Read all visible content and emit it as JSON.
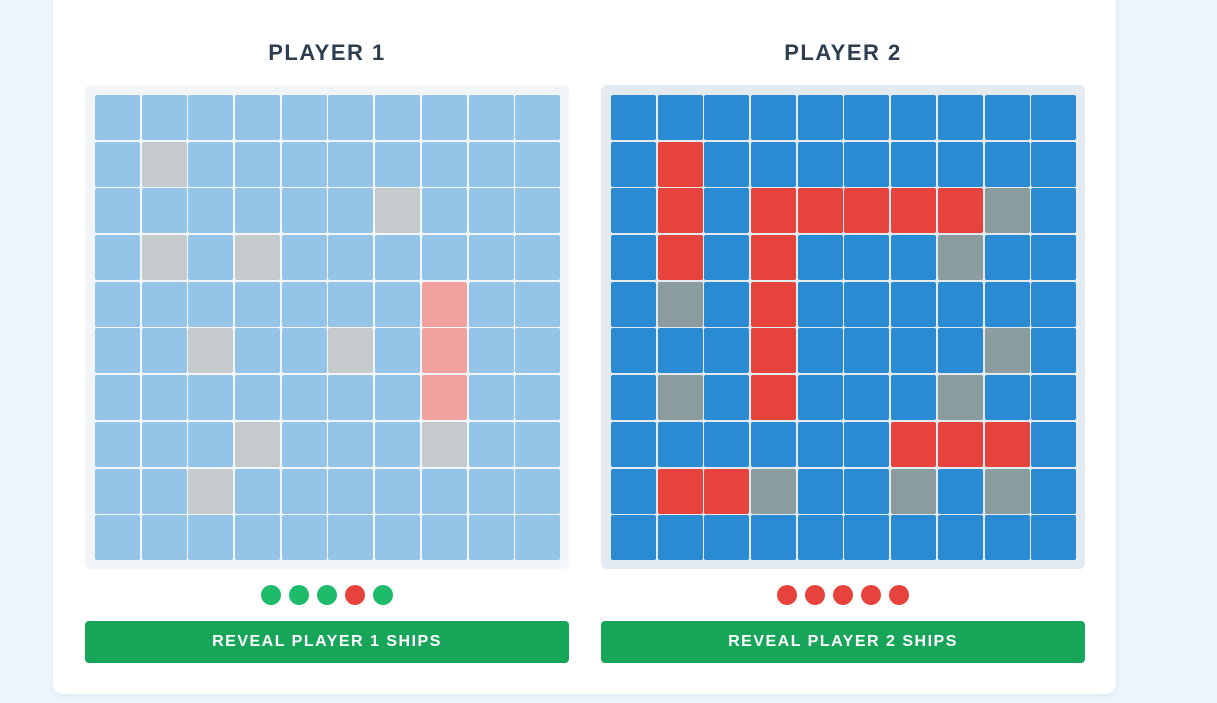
{
  "players": [
    {
      "title": "PLAYER 1",
      "reveal_label": "REVEAL PLAYER 1 SHIPS",
      "ship_status": [
        "alive",
        "alive",
        "alive",
        "sunk",
        "alive"
      ],
      "grid": [
        [
          "water",
          "water",
          "water",
          "water",
          "water",
          "water",
          "water",
          "water",
          "water",
          "water"
        ],
        [
          "water",
          "miss",
          "water",
          "water",
          "water",
          "water",
          "water",
          "water",
          "water",
          "water"
        ],
        [
          "water",
          "water",
          "water",
          "water",
          "water",
          "water",
          "miss",
          "water",
          "water",
          "water"
        ],
        [
          "water",
          "miss",
          "water",
          "miss",
          "water",
          "water",
          "water",
          "water",
          "water",
          "water"
        ],
        [
          "water",
          "water",
          "water",
          "water",
          "water",
          "water",
          "water",
          "hit",
          "water",
          "water"
        ],
        [
          "water",
          "water",
          "miss",
          "water",
          "water",
          "miss",
          "water",
          "hit",
          "water",
          "water"
        ],
        [
          "water",
          "water",
          "water",
          "water",
          "water",
          "water",
          "water",
          "hit",
          "water",
          "water"
        ],
        [
          "water",
          "water",
          "water",
          "miss",
          "water",
          "water",
          "water",
          "miss",
          "water",
          "water"
        ],
        [
          "water",
          "water",
          "miss",
          "water",
          "water",
          "water",
          "water",
          "water",
          "water",
          "water"
        ],
        [
          "water",
          "water",
          "water",
          "water",
          "water",
          "water",
          "water",
          "water",
          "water",
          "water"
        ]
      ]
    },
    {
      "title": "PLAYER 2",
      "reveal_label": "REVEAL PLAYER 2 SHIPS",
      "ship_status": [
        "sunk",
        "sunk",
        "sunk",
        "sunk",
        "sunk"
      ],
      "grid": [
        [
          "water",
          "water",
          "water",
          "water",
          "water",
          "water",
          "water",
          "water",
          "water",
          "water"
        ],
        [
          "water",
          "hit",
          "water",
          "water",
          "water",
          "water",
          "water",
          "water",
          "water",
          "water"
        ],
        [
          "water",
          "hit",
          "water",
          "hit",
          "hit",
          "hit",
          "hit",
          "hit",
          "miss",
          "water"
        ],
        [
          "water",
          "hit",
          "water",
          "hit",
          "water",
          "water",
          "water",
          "miss",
          "water",
          "water"
        ],
        [
          "water",
          "miss",
          "water",
          "hit",
          "water",
          "water",
          "water",
          "water",
          "water",
          "water"
        ],
        [
          "water",
          "water",
          "water",
          "hit",
          "water",
          "water",
          "water",
          "water",
          "miss",
          "water"
        ],
        [
          "water",
          "miss",
          "water",
          "hit",
          "water",
          "water",
          "water",
          "miss",
          "water",
          "water"
        ],
        [
          "water",
          "water",
          "water",
          "water",
          "water",
          "water",
          "hit",
          "hit",
          "hit",
          "water"
        ],
        [
          "water",
          "hit",
          "hit",
          "miss",
          "water",
          "water",
          "miss",
          "water",
          "miss",
          "water"
        ],
        [
          "water",
          "water",
          "water",
          "water",
          "water",
          "water",
          "water",
          "water",
          "water",
          "water"
        ]
      ]
    }
  ],
  "colors": {
    "alive": "#1dbb6a",
    "sunk": "#e6433c",
    "button": "#17a55a"
  }
}
